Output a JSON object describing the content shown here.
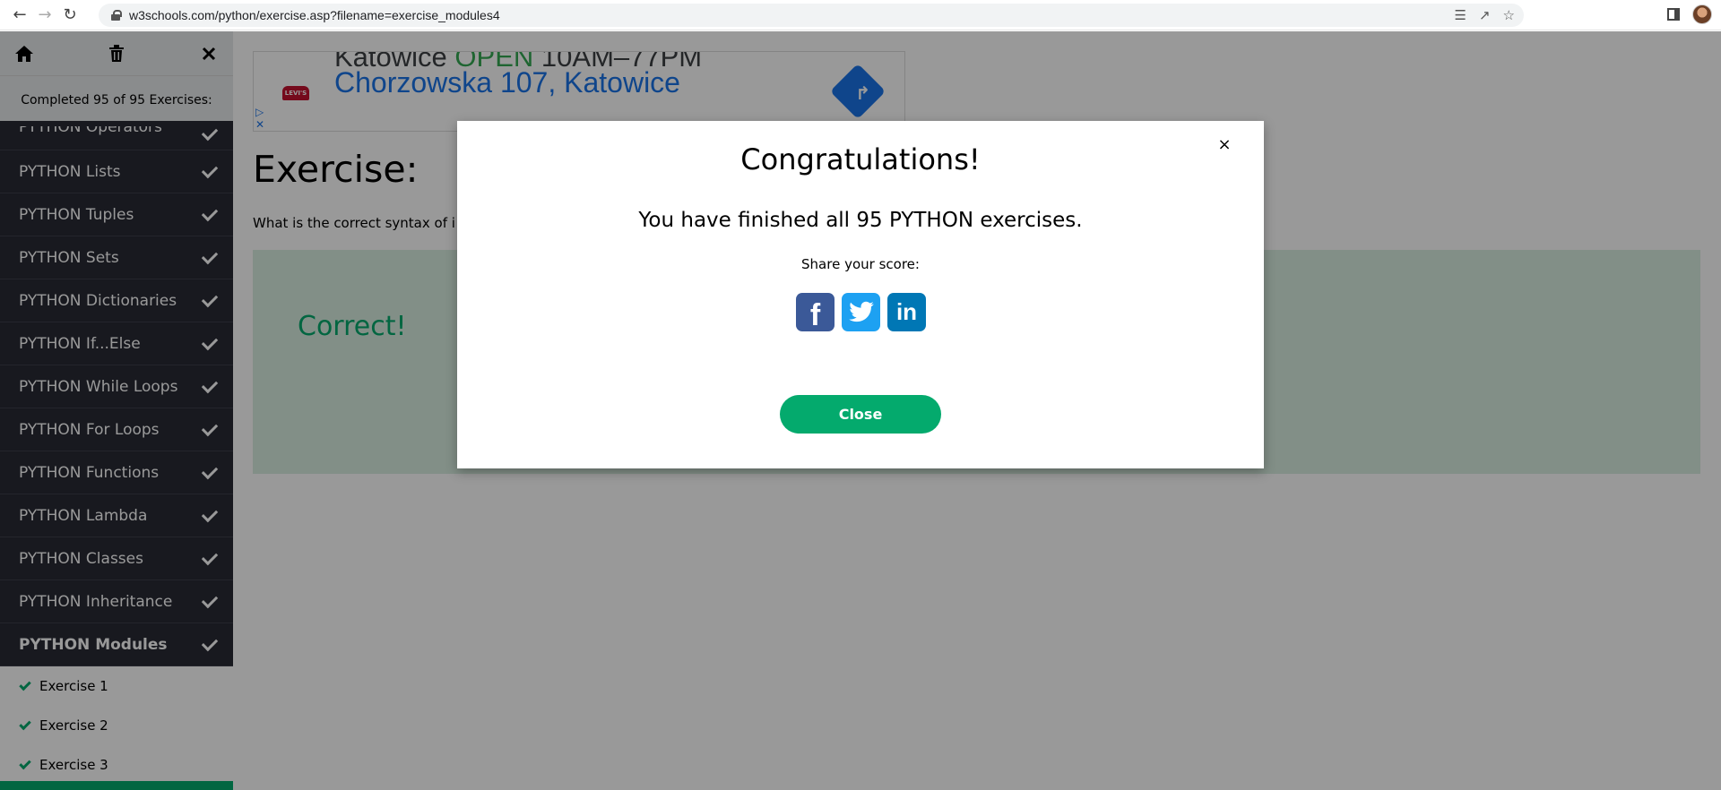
{
  "browser": {
    "url": "w3schools.com/python/exercise.asp?filename=exercise_modules4"
  },
  "sidebar": {
    "completed_text": "Completed 95 of 95 Exercises:",
    "topics": [
      {
        "label": "PYTHON Operators"
      },
      {
        "label": "PYTHON Lists"
      },
      {
        "label": "PYTHON Tuples"
      },
      {
        "label": "PYTHON Sets"
      },
      {
        "label": "PYTHON Dictionaries"
      },
      {
        "label": "PYTHON If...Else"
      },
      {
        "label": "PYTHON While Loops"
      },
      {
        "label": "PYTHON For Loops"
      },
      {
        "label": "PYTHON Functions"
      },
      {
        "label": "PYTHON Lambda"
      },
      {
        "label": "PYTHON Classes"
      },
      {
        "label": "PYTHON Inheritance"
      },
      {
        "label": "PYTHON Modules"
      }
    ],
    "exercises": [
      {
        "label": "Exercise 1"
      },
      {
        "label": "Exercise 2"
      },
      {
        "label": "Exercise 3"
      }
    ]
  },
  "ad": {
    "line1_city": "Katowice",
    "line1_status": "OPEN",
    "line1_hours": "10AM–77PM",
    "line2_address": "Chorzowska 107, Katowice",
    "logo_text": "LEVI'S"
  },
  "main": {
    "heading": "Exercise:",
    "question": "What is the correct syntax of i",
    "result": "Correct!"
  },
  "modal": {
    "close_symbol": "×",
    "title": "Congratulations!",
    "message": "You have finished all 95 PYTHON exercises.",
    "share_label": "Share your score:",
    "button_label": "Close"
  },
  "colors": {
    "sidebar_bg": "#282a35",
    "accent_green": "#04aa6d",
    "facebook": "#3b5998",
    "twitter": "#1da1f2",
    "linkedin": "#0077b5"
  }
}
